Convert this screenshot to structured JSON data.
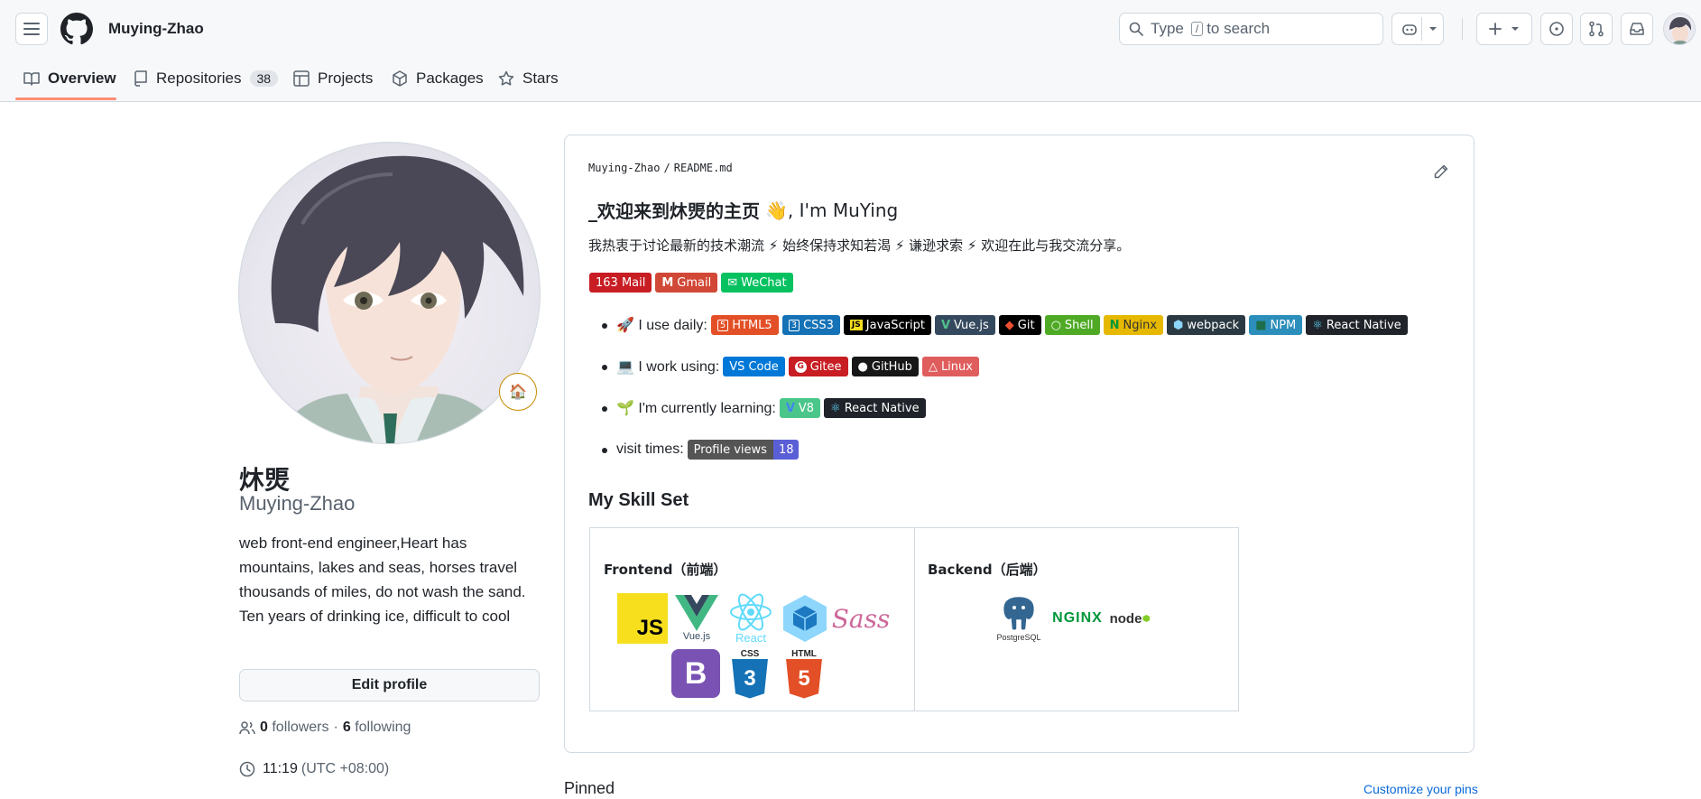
{
  "header": {
    "username": "Muying-Zhao",
    "search_text_before": "Type",
    "search_key": "/",
    "search_text_after": "to search"
  },
  "nav": {
    "tabs": [
      {
        "label": "Overview"
      },
      {
        "label": "Repositories",
        "count": "38"
      },
      {
        "label": "Projects"
      },
      {
        "label": "Packages"
      },
      {
        "label": "Stars"
      }
    ]
  },
  "profile": {
    "name": "炑煚",
    "login": "Muying-Zhao",
    "bio": "web front-end engineer,Heart has mountains, lakes and seas, horses travel thousands of miles, do not wash the sand. Ten years of drinking ice, difficult to cool",
    "edit_label": "Edit profile",
    "followers_count": "0",
    "followers_label": "followers",
    "separator": "·",
    "following_count": "6",
    "following_label": "following",
    "time": "11:19",
    "timezone": "(UTC +08:00)",
    "status_emoji": "🏠"
  },
  "readme": {
    "path_user": "Muying-Zhao",
    "path_sep": "/",
    "path_file": "README.md",
    "heading_prefix": "_欢迎来到炑煚的主页",
    "heading_emoji": "👋",
    "heading_suffix": ", I'm MuYing",
    "intro": "我热衷于讨论最新的技术潮流 ⚡ 始终保持求知若渴 ⚡ 谦逊求索 ⚡ 欢迎在此与我交流分享。",
    "contact_badges": [
      {
        "label": "163 Mail",
        "color": "#c71d23"
      },
      {
        "label": "Gmail",
        "color": "#d14836",
        "icon": "M"
      },
      {
        "label": "WeChat",
        "color": "#07c160",
        "icon": "✉"
      }
    ],
    "use_daily_label": "🚀 I use daily:",
    "use_daily": [
      {
        "label": "HTML5",
        "color": "#e34f26",
        "icon": "5"
      },
      {
        "label": "CSS3",
        "color": "#1572b6",
        "icon": "3"
      },
      {
        "label": "JavaScript",
        "color": "#000000",
        "icon": "JS",
        "icon_bg": "#f7df1e"
      },
      {
        "label": "Vue.js",
        "color": "#35495e",
        "icon": "V",
        "icon_color": "#4fc08d"
      },
      {
        "label": "Git",
        "color": "#000000",
        "icon": "◆",
        "icon_color": "#f05032"
      },
      {
        "label": "Shell",
        "color": "#4eaa25",
        "icon": "○"
      },
      {
        "label": "Nginx",
        "color": "#e6b800",
        "icon": "N",
        "icon_color": "#009639",
        "text_color": "#333333"
      },
      {
        "label": "webpack",
        "color": "#2b3a42",
        "icon": "⬢",
        "icon_color": "#8dd6f9"
      },
      {
        "label": "NPM",
        "color": "#2c8ebb",
        "icon": "■",
        "icon_color": "#1f6e4a"
      },
      {
        "label": "React Native",
        "color": "#20232a",
        "icon": "⚛",
        "icon_color": "#61dafb"
      }
    ],
    "work_using_label": "💻 I work using:",
    "work_using": [
      {
        "label": "VS Code",
        "color": "#0078d7"
      },
      {
        "label": "Gitee",
        "color": "#c71d23",
        "icon": "G"
      },
      {
        "label": "GitHub",
        "color": "#181717",
        "icon": "●"
      },
      {
        "label": "Linux",
        "color": "#e05d5d",
        "icon": "△"
      }
    ],
    "learning_label": "🌱 I'm currently learning:",
    "learning": [
      {
        "label": "V8",
        "color": "#4bc68a",
        "icon": "V",
        "icon_color": "#4285f4"
      },
      {
        "label": "React Native",
        "color": "#20232a",
        "icon": "⚛",
        "icon_color": "#61dafb"
      }
    ],
    "visit_label": "visit times:",
    "views_label": "Profile views",
    "views_count": "18",
    "skill_heading": "My Skill Set",
    "frontend_label": "Frontend（前端）",
    "backend_label": "Backend（后端）",
    "frontend_logos": {
      "js": "JS",
      "vue_text": "Vue.js",
      "react_text": "React",
      "sass_text": "Sass",
      "bootstrap": "B",
      "css_text": "CSS",
      "css_num": "3",
      "html_text": "HTML",
      "html_num": "5"
    },
    "backend_logos": {
      "postgres_text": "PostgreSQL",
      "nginx_text": "NGINX",
      "node_text": "node"
    }
  },
  "pinned": {
    "label": "Pinned",
    "customize_label": "Customize your pins"
  },
  "colors": {
    "link": "#0969da",
    "tab_underline": "#fd8c73",
    "border": "#d1d9e0"
  }
}
